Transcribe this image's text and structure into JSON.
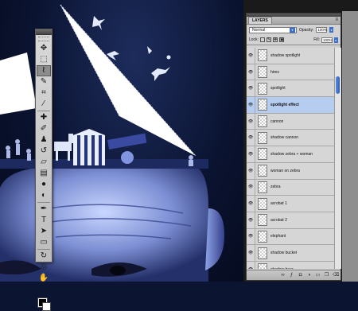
{
  "layers_panel": {
    "tab_label": "LAYERS",
    "blend_mode": "Normal",
    "opacity_label": "Opacity:",
    "opacity_value": "100%",
    "lock_label": "Lock:",
    "fill_label": "Fill:",
    "fill_value": "100%",
    "layers": [
      {
        "name": "shadow spotlight"
      },
      {
        "name": "hires"
      },
      {
        "name": "spotlight"
      },
      {
        "name": "spotlight effect",
        "active": true
      },
      {
        "name": "cannon"
      },
      {
        "name": "shadow cannon"
      },
      {
        "name": "shadow zebra + woman"
      },
      {
        "name": "woman on zebra"
      },
      {
        "name": "zebra"
      },
      {
        "name": "acrobat 1"
      },
      {
        "name": "acrobat 2"
      },
      {
        "name": "elephant"
      },
      {
        "name": "shadow bucket"
      },
      {
        "name": "shadow bear"
      }
    ],
    "footer_icons": [
      "link-icon",
      "fx-icon",
      "mask-icon",
      "adjustment-icon",
      "group-folder-icon",
      "new-layer-icon",
      "trash-icon"
    ]
  },
  "tools": [
    {
      "icon": "move-icon",
      "glyph": "✥"
    },
    {
      "icon": "marquee-icon",
      "glyph": "⬚"
    },
    {
      "icon": "lasso-icon",
      "glyph": "ℓ",
      "selected": true
    },
    {
      "icon": "quick-select-icon",
      "glyph": "✎"
    },
    {
      "icon": "crop-icon",
      "glyph": "⌗"
    },
    {
      "icon": "eyedropper-icon",
      "glyph": "⁄"
    },
    {
      "sep": true
    },
    {
      "icon": "healing-brush-icon",
      "glyph": "✚"
    },
    {
      "icon": "brush-icon",
      "glyph": "✐"
    },
    {
      "icon": "clone-stamp-icon",
      "glyph": "♟"
    },
    {
      "icon": "history-brush-icon",
      "glyph": "↺"
    },
    {
      "icon": "eraser-icon",
      "glyph": "▱"
    },
    {
      "icon": "gradient-icon",
      "glyph": "▤"
    },
    {
      "icon": "blur-icon",
      "glyph": "●"
    },
    {
      "icon": "dodge-icon",
      "glyph": "◐"
    },
    {
      "sep": true
    },
    {
      "icon": "pen-icon",
      "glyph": "✒"
    },
    {
      "icon": "type-icon",
      "glyph": "T"
    },
    {
      "icon": "path-select-icon",
      "glyph": "➤"
    },
    {
      "icon": "shape-icon",
      "glyph": "▭"
    },
    {
      "sep": true
    },
    {
      "icon": "3d-rotate-icon",
      "glyph": "↻"
    },
    {
      "icon": "3d-orbit-icon",
      "glyph": "◎"
    },
    {
      "icon": "hand-icon",
      "glyph": "✋"
    },
    {
      "icon": "zoom-icon",
      "glyph": "⌕"
    }
  ],
  "colors": {
    "foreground": "#000000",
    "background": "#ffffff",
    "active_layer": "#b7cdf0",
    "scroll_accent": "#3a6fd0"
  }
}
